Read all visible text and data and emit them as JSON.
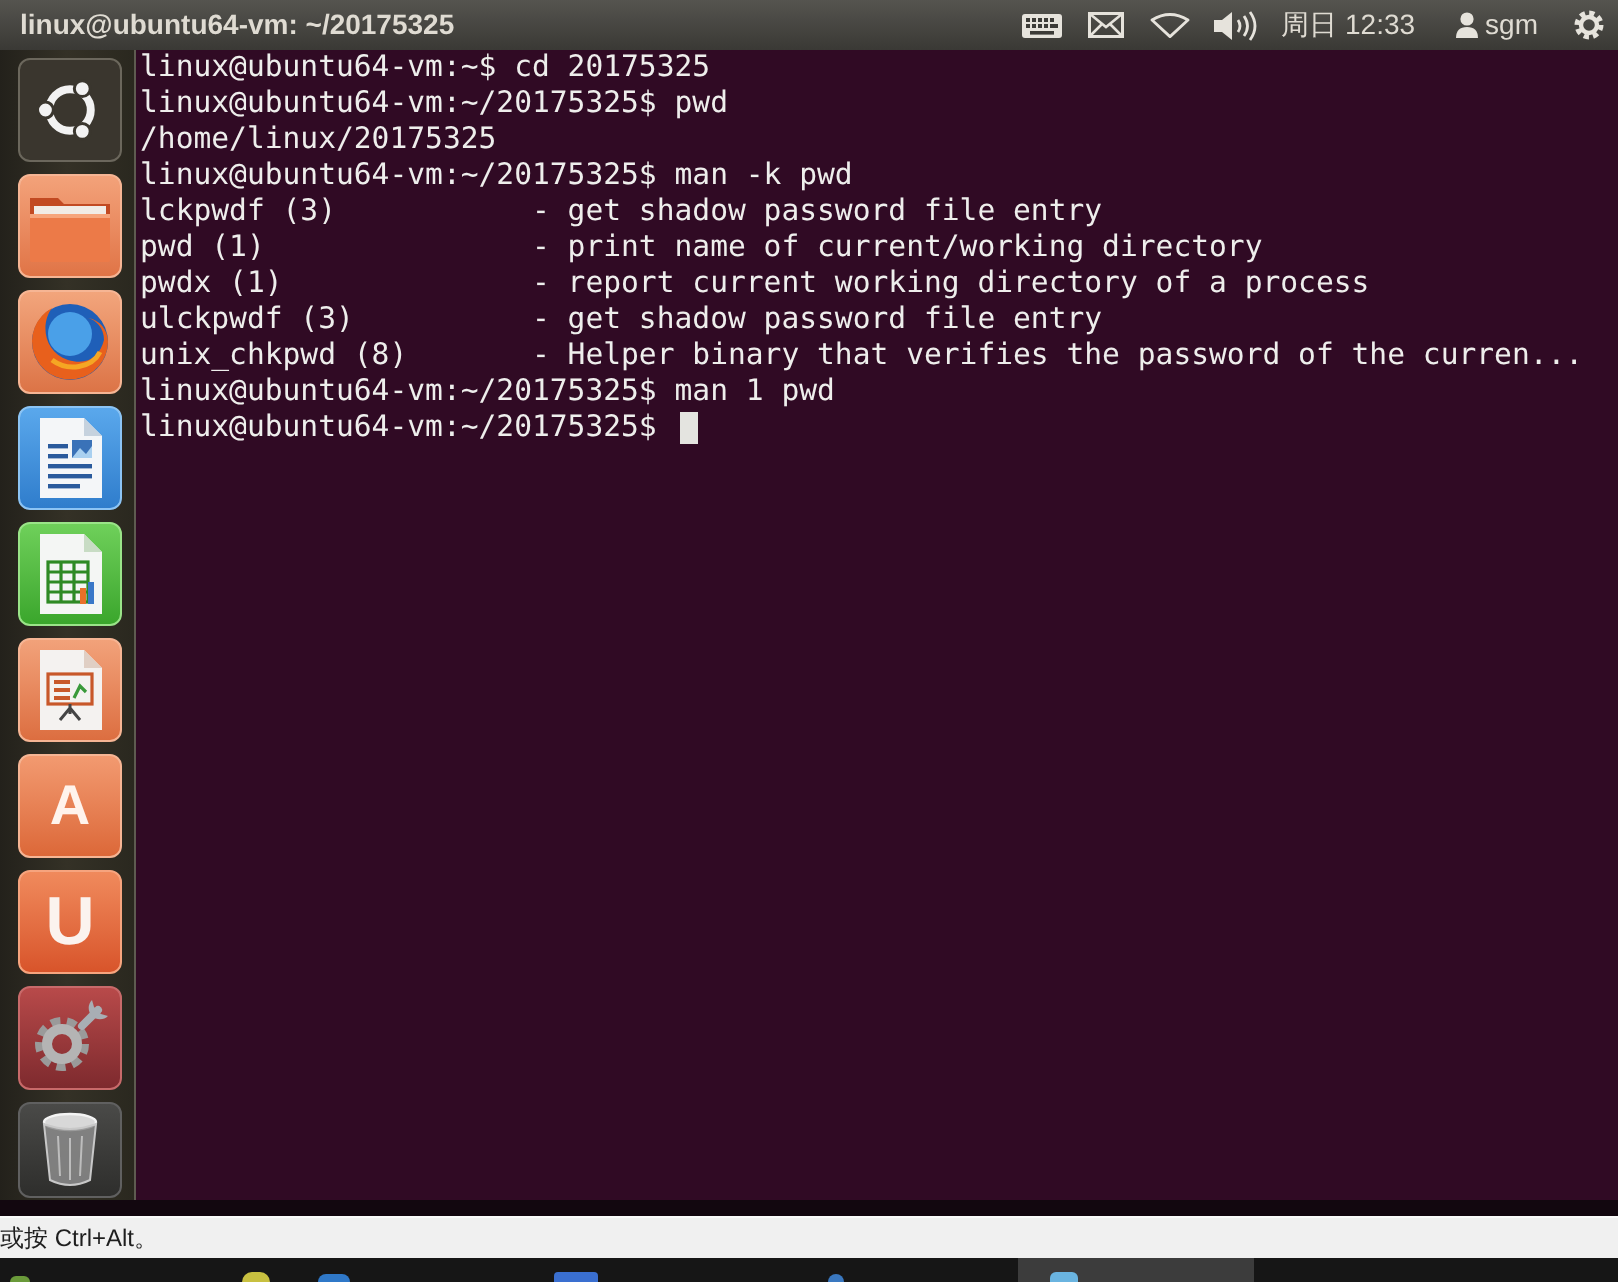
{
  "top_panel": {
    "title": "linux@ubuntu64-vm: ~/20175325",
    "clock": "周日 12:33",
    "user": "sgm"
  },
  "launcher": {
    "items": [
      {
        "kind": "dash"
      },
      {
        "kind": "files"
      },
      {
        "kind": "browser"
      },
      {
        "kind": "writer"
      },
      {
        "kind": "calc"
      },
      {
        "kind": "impress"
      },
      {
        "kind": "software",
        "glyph": "A"
      },
      {
        "kind": "cloud",
        "glyph": "U"
      },
      {
        "kind": "settings"
      },
      {
        "kind": "trash"
      }
    ]
  },
  "terminal": {
    "lines": [
      "linux@ubuntu64-vm:~$ cd 20175325",
      "linux@ubuntu64-vm:~/20175325$ pwd",
      "/home/linux/20175325",
      "linux@ubuntu64-vm:~/20175325$ man -k pwd",
      "lckpwdf (3)           - get shadow password file entry",
      "pwd (1)               - print name of current/working directory",
      "pwdx (1)              - report current working directory of a process",
      "ulckpwdf (3)          - get shadow password file entry",
      "unix_chkpwd (8)       - Helper binary that verifies the password of the curren...",
      "linux@ubuntu64-vm:~/20175325$ man 1 pwd",
      "linux@ubuntu64-vm:~/20175325$"
    ],
    "cursor_visible": true
  },
  "hint_bar": {
    "text": "或按 Ctrl+Alt。"
  }
}
